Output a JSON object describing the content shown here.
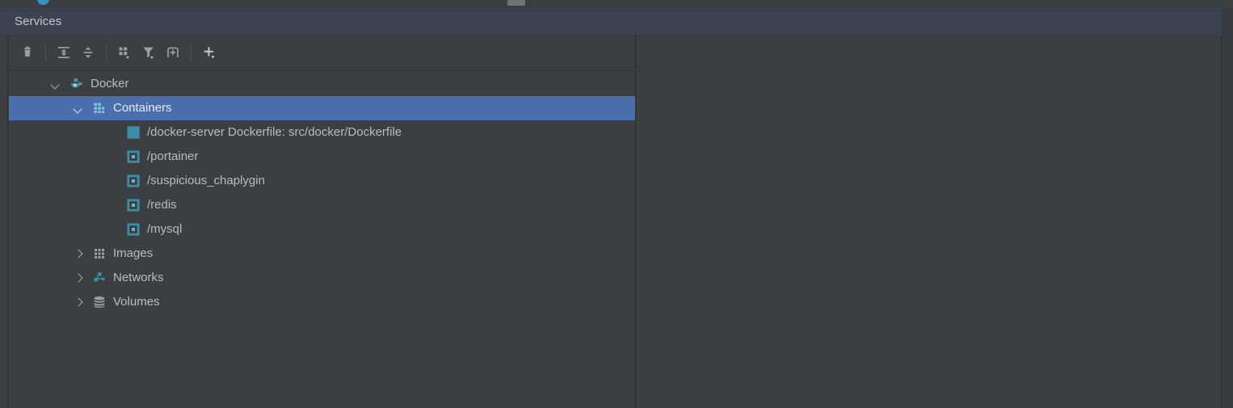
{
  "window": {
    "title": "Services"
  },
  "toolbar": {
    "buttons": [
      {
        "name": "delete-icon",
        "tooltip": "Delete",
        "dropdown": false
      },
      {
        "name": "expand-all-icon",
        "tooltip": "Expand All",
        "dropdown": false
      },
      {
        "name": "collapse-all-icon",
        "tooltip": "Collapse All",
        "dropdown": false
      },
      {
        "name": "group-by-icon",
        "tooltip": "Group By",
        "dropdown": true
      },
      {
        "name": "filter-icon",
        "tooltip": "Filter",
        "dropdown": true
      },
      {
        "name": "add-tab-icon",
        "tooltip": "Open in New Tab",
        "dropdown": false
      },
      {
        "name": "add-service-icon",
        "tooltip": "Add Service",
        "dropdown": true
      }
    ]
  },
  "colors": {
    "selection": "#4b6eaf",
    "panel_background": "#3c3f41",
    "titlebar_background": "#3c4350",
    "text": "#bbbbbb",
    "docker_blue": "#3c8dbc",
    "container_teal": "#3d8ca8",
    "run_green": "#59a869",
    "grey_icon": "#9aa0a6"
  },
  "tree": {
    "nodes": [
      {
        "label": "Docker",
        "icon": "docker-whale-running-icon",
        "depth": 0,
        "expander": "down",
        "selected": false
      },
      {
        "label": "Containers",
        "icon": "containers-grid-icon",
        "depth": 1,
        "expander": "down",
        "selected": true
      },
      {
        "label": "/docker-server Dockerfile: src/docker/Dockerfile",
        "icon": "container-running-icon",
        "depth": 2,
        "expander": "none",
        "selected": false
      },
      {
        "label": "/portainer",
        "icon": "container-stopped-icon",
        "depth": 2,
        "expander": "none",
        "selected": false
      },
      {
        "label": "/suspicious_chaplygin",
        "icon": "container-stopped-icon",
        "depth": 2,
        "expander": "none",
        "selected": false
      },
      {
        "label": "/redis",
        "icon": "container-stopped-icon",
        "depth": 2,
        "expander": "none",
        "selected": false
      },
      {
        "label": "/mysql",
        "icon": "container-stopped-icon",
        "depth": 2,
        "expander": "none",
        "selected": false
      },
      {
        "label": "Images",
        "icon": "images-grid-icon",
        "depth": 1,
        "expander": "right",
        "selected": false
      },
      {
        "label": "Networks",
        "icon": "networks-icon",
        "depth": 1,
        "expander": "right",
        "selected": false
      },
      {
        "label": "Volumes",
        "icon": "volumes-icon",
        "depth": 1,
        "expander": "right",
        "selected": false
      }
    ]
  }
}
